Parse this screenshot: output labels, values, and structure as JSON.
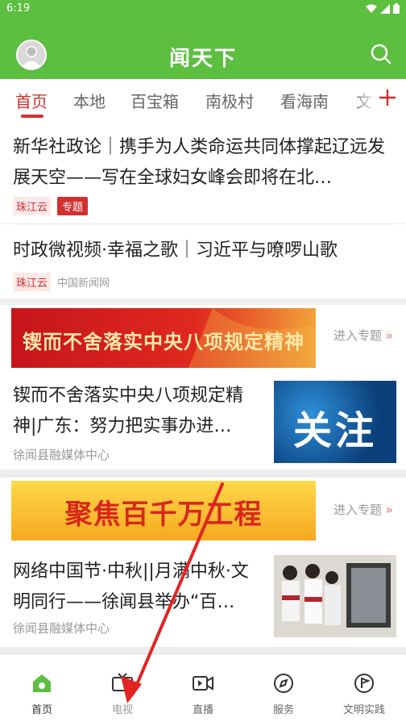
{
  "status": {
    "time": "6:19"
  },
  "appbar": {
    "title": "闻天下"
  },
  "tabs": [
    "首页",
    "本地",
    "百宝箱",
    "南极村",
    "看海南",
    "文"
  ],
  "colors": {
    "brand": "#5cbf3f",
    "accent": "#d32f2f"
  },
  "news1": {
    "headline": "新华社政论｜携手为人类命运共同体撑起辽远发展天空——写在全球妇女峰会即将在北…",
    "source": "珠江云",
    "topic": "专题"
  },
  "news2": {
    "headline": "时政微视频·幸福之歌｜习近平与嘹啰山歌",
    "source": "珠江云",
    "publisher": "中国新闻网"
  },
  "banner1": {
    "text": "锲而不舍落实中央八项规定精神",
    "enter": "进入专题",
    "arrow": "»"
  },
  "article1": {
    "headline": "锲而不舍落实中央八项规定精神|广东：努力把实事办进…",
    "source": "徐闻县融媒体中心",
    "thumb_text": "关注"
  },
  "banner2": {
    "text": "聚焦百千万工程",
    "enter": "进入专题",
    "arrow": "»"
  },
  "article2": {
    "headline": "网络中国节·中秋||月满中秋·文明同行——徐闻县举办“百…",
    "source": "徐闻县融媒体中心"
  },
  "bottom_nav": [
    {
      "label": "首页",
      "icon": "home-icon"
    },
    {
      "label": "电视",
      "icon": "tv-icon"
    },
    {
      "label": "直播",
      "icon": "live-icon"
    },
    {
      "label": "服务",
      "icon": "compass-icon"
    },
    {
      "label": "文明实践",
      "icon": "flag-icon"
    }
  ]
}
